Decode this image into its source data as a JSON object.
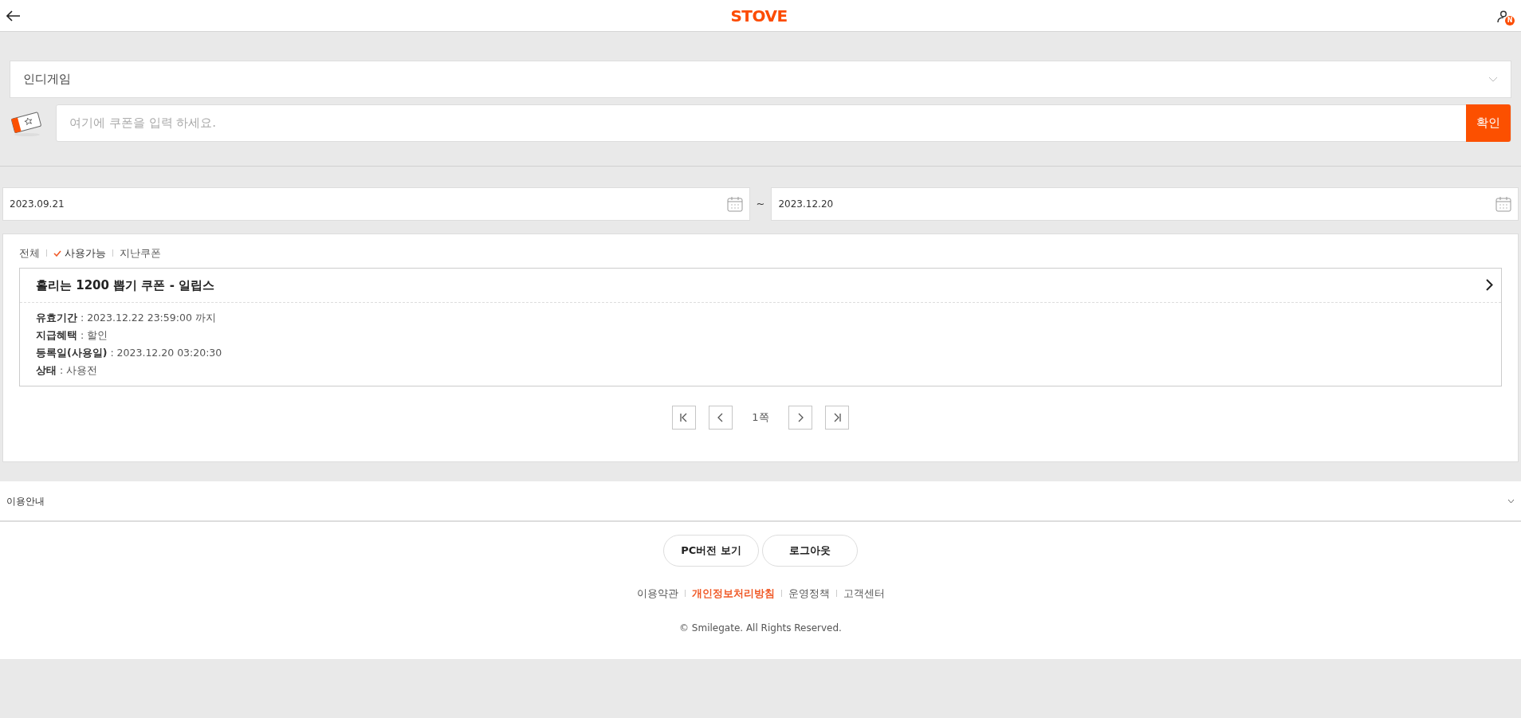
{
  "header": {
    "logo": "STOVE",
    "profile_badge": "N"
  },
  "game_select": {
    "value": "인디게임"
  },
  "coupon_input": {
    "placeholder": "여기에 쿠폰을 입력 하세요.",
    "button": "확인"
  },
  "date_range": {
    "start": "2023.09.21",
    "separator": "~",
    "end": "2023.12.20"
  },
  "filters": [
    {
      "label": "전체",
      "selected": false
    },
    {
      "label": "사용가능",
      "selected": true
    },
    {
      "label": "지난쿠폰",
      "selected": false
    }
  ],
  "coupons": [
    {
      "title": "홀리는 1200 뽑기 쿠폰 - 일립스",
      "details": [
        "**유효기간** : 2023.12.22 23:59:00 까지",
        "**지급혜택** : 할인",
        "**등록일(사용일)** : 2023.12.20 03:20:30",
        "**상태** : 사용전"
      ]
    }
  ],
  "pagination": {
    "page": "1쪽"
  },
  "usage_guide": {
    "label": "이용안내",
    "expanded": false
  },
  "footer": {
    "buttons": [
      "PC버전 보기",
      "로그아웃"
    ],
    "links": [
      {
        "label": "이용약관",
        "emphasized": false
      },
      {
        "label": "개인정보처리방침",
        "emphasized": true
      },
      {
        "label": "운영정책",
        "emphasized": false
      },
      {
        "label": "고객센터",
        "emphasized": false
      }
    ],
    "copyright": "© Smilegate. All Rights Reserved."
  }
}
